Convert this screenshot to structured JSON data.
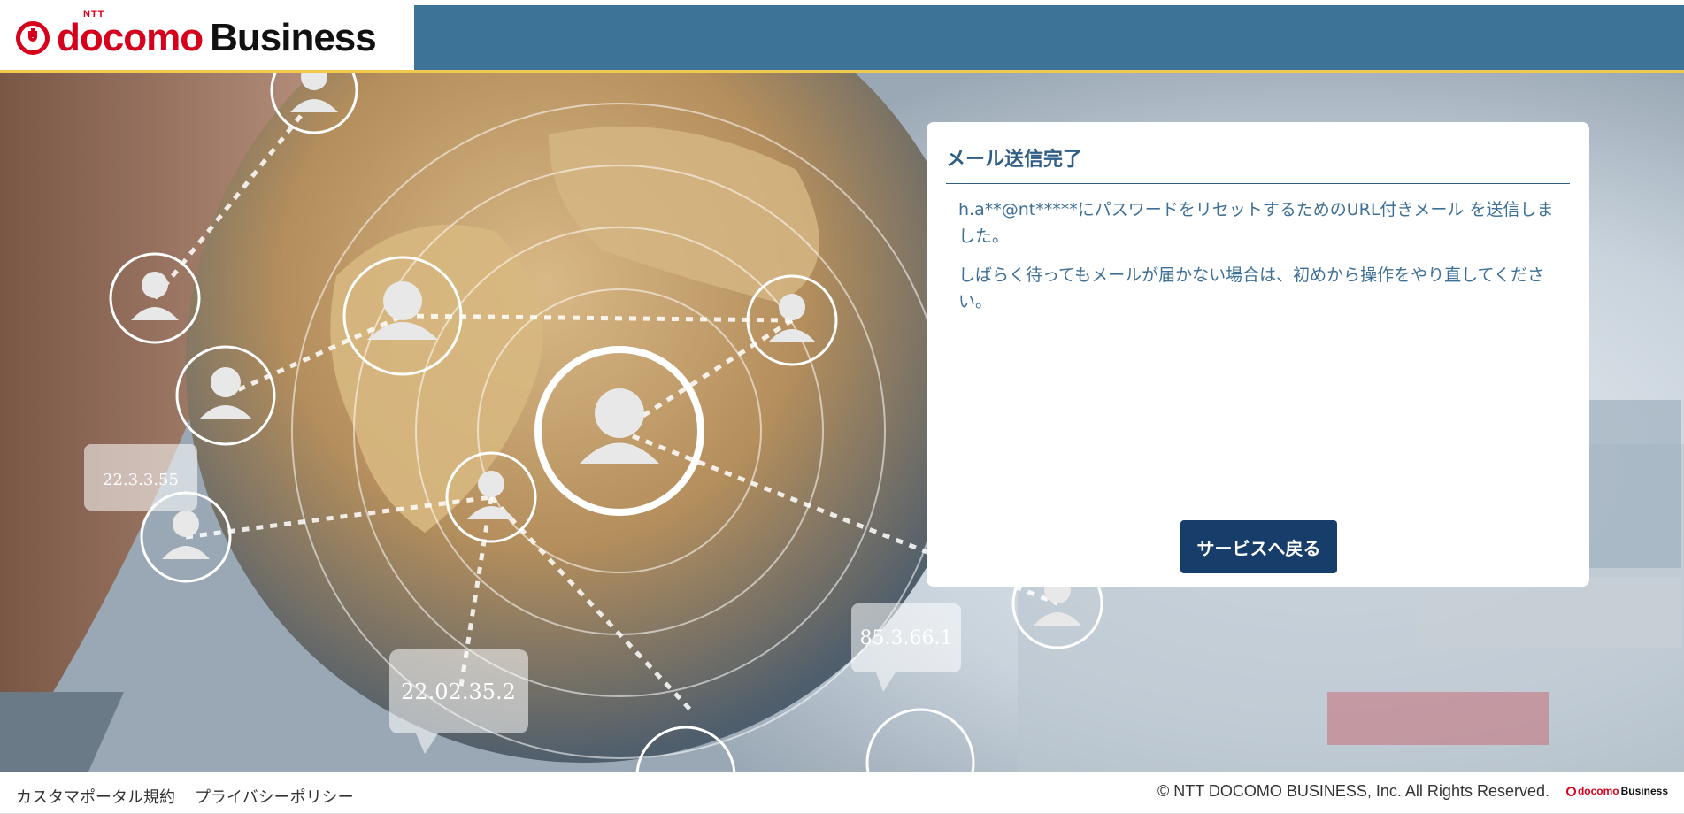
{
  "header": {
    "logo": {
      "ntt": "NTT",
      "docomo": "docomo",
      "business": "Business"
    }
  },
  "hero": {
    "ip_labels": [
      "22.3.3.55",
      "22.02.35.2",
      "85.3.66.1"
    ]
  },
  "card": {
    "title": "メール送信完了",
    "message1": "h.a**@nt*****にパスワードをリセットするためのURL付きメール を送信しました。",
    "message2": "しばらく待ってもメールが届かない場合は、初めから操作をやり直してください。",
    "button_label": "サービスへ戻る"
  },
  "footer": {
    "links": [
      "カスタマポータル規約",
      "プライバシーポリシー"
    ],
    "copyright": "© NTT DOCOMO BUSINESS, Inc. All Rights Reserved.",
    "logo": {
      "docomo": "docomo",
      "business": "Business"
    }
  },
  "colors": {
    "header_bg": "#3e7398",
    "header_border": "#f2c94c",
    "brand_red": "#d6001c",
    "title_color": "#2f5d85",
    "text_color": "#3e6f96",
    "button_bg": "#173e6b"
  }
}
